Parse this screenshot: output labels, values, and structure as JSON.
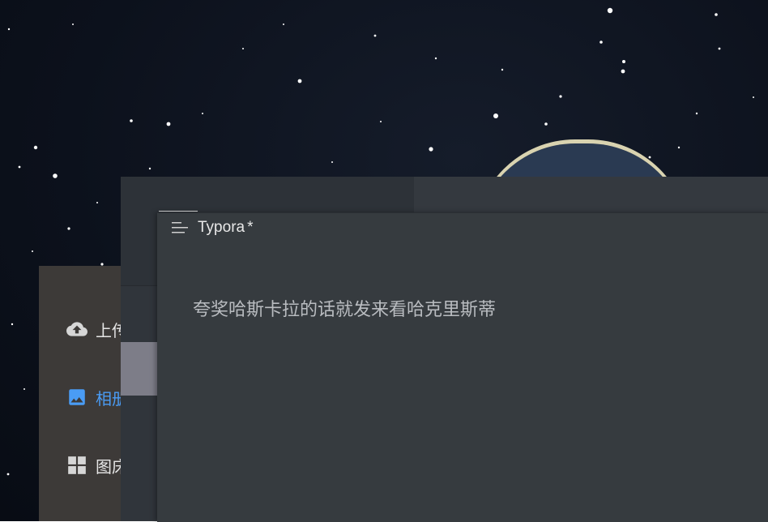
{
  "wallpaper": {
    "background": "starry-night",
    "planet_rim_color": "#d9d3b0"
  },
  "picgo": {
    "items": [
      {
        "label": "上传",
        "icon": "cloud-upload-icon",
        "active": false
      },
      {
        "label": "相册",
        "icon": "image-icon",
        "active": true
      },
      {
        "label": "图床",
        "icon": "grid-icon",
        "active": false
      }
    ],
    "colors": {
      "active": "#4a9cf5",
      "text": "#e6e6e6",
      "panel": "#3d3a38"
    }
  },
  "typora": {
    "title": "Typora",
    "modified_marker": "*",
    "content": "夸奖哈斯卡拉的话就发来看哈克里斯蒂",
    "colors": {
      "background": "#363b3f",
      "text": "#b9bcc0"
    }
  }
}
